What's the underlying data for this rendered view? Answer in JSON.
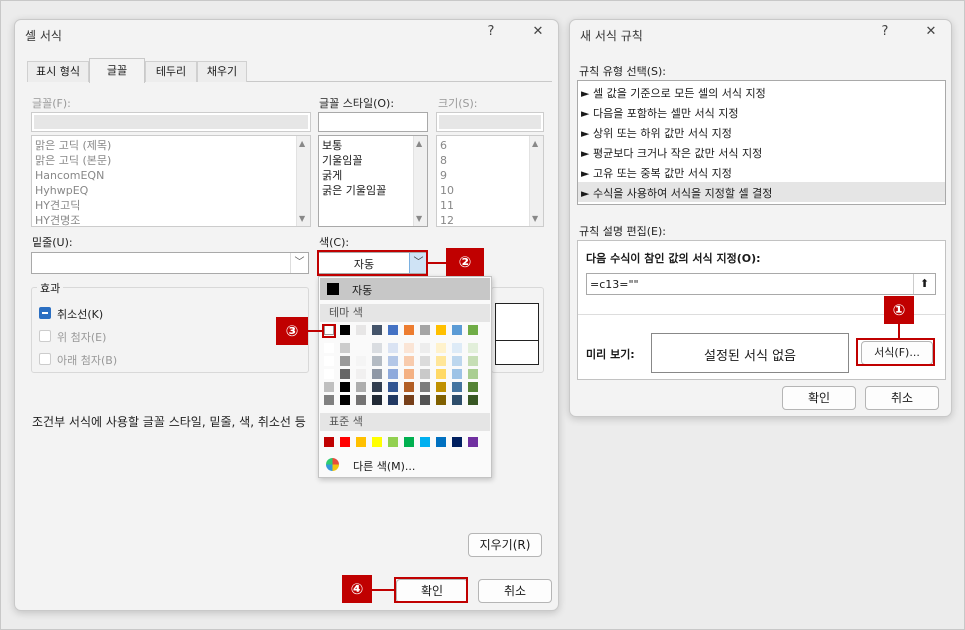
{
  "left_dialog": {
    "title": "셀 서식",
    "help": "?",
    "close": "✕",
    "tabs": [
      "표시 형식",
      "글꼴",
      "테두리",
      "채우기"
    ],
    "font_label": "글꼴(F):",
    "font_list": [
      "맑은 고딕 (제목)",
      "맑은 고딕 (본문)",
      "HancomEQN",
      "HyhwpEQ",
      "HY견고딕",
      "HY견명조"
    ],
    "style_label": "글꼴 스타일(O):",
    "style_list": [
      "보통",
      "기울임꼴",
      "굵게",
      "굵은 기울임꼴"
    ],
    "size_label": "크기(S):",
    "size_list": [
      "6",
      "8",
      "9",
      "10",
      "11",
      "12"
    ],
    "underline_label": "밑줄(U):",
    "color_label": "색(C):",
    "color_value": "자동",
    "effects_label": "효과",
    "effects": [
      {
        "label": "취소선(K)",
        "checked": true
      },
      {
        "label": "위 첨자(E)",
        "checked": false
      },
      {
        "label": "아래 첨자(B)",
        "checked": false
      }
    ],
    "info_text": "조건부 서식에 사용할 글꼴 스타일, 밑줄, 색, 취소선 등",
    "clear_button": "지우기(R)",
    "ok_button": "확인",
    "cancel_button": "취소"
  },
  "color_popup": {
    "auto": "자동",
    "theme_label": "테마 색",
    "standard_label": "표준 색",
    "more_colors": "다른 색(M)...",
    "theme_colors": [
      "#ffffff",
      "#000000",
      "#e7e6e6",
      "#44546a",
      "#4472c4",
      "#ed7d31",
      "#a5a5a5",
      "#ffc000",
      "#5b9bd5",
      "#70ad47"
    ],
    "standard_colors": [
      "#c00000",
      "#ff0000",
      "#ffc000",
      "#ffff00",
      "#92d050",
      "#00b050",
      "#00b0f0",
      "#0070c0",
      "#002060",
      "#7030a0"
    ]
  },
  "right_dialog": {
    "title": "새 서식 규칙",
    "help": "?",
    "close": "✕",
    "rule_type_label": "규칙 유형 선택(S):",
    "rule_types": [
      "► 셀 값을 기준으로 모든 셀의 서식 지정",
      "► 다음을 포함하는 셀만 서식 지정",
      "► 상위 또는 하위 값만 서식 지정",
      "► 평균보다 크거나 작은 값만 서식 지정",
      "► 고유 또는 중복 값만 서식 지정",
      "► 수식을 사용하여 서식을 지정할 셀 결정"
    ],
    "desc_label": "규칙 설명 편집(E):",
    "formula_label": "다음 수식이 참인 값의 서식 지정(O):",
    "formula_value": "=c13=\"\"",
    "preview_label": "미리 보기:",
    "preview_text": "설정된 서식 없음",
    "format_button": "서식(F)...",
    "ok_button": "확인",
    "cancel_button": "취소"
  },
  "callouts": [
    "①",
    "②",
    "③",
    "④"
  ],
  "colors": {
    "accent": "#c00000",
    "selected_row": "#e5e5e5"
  }
}
